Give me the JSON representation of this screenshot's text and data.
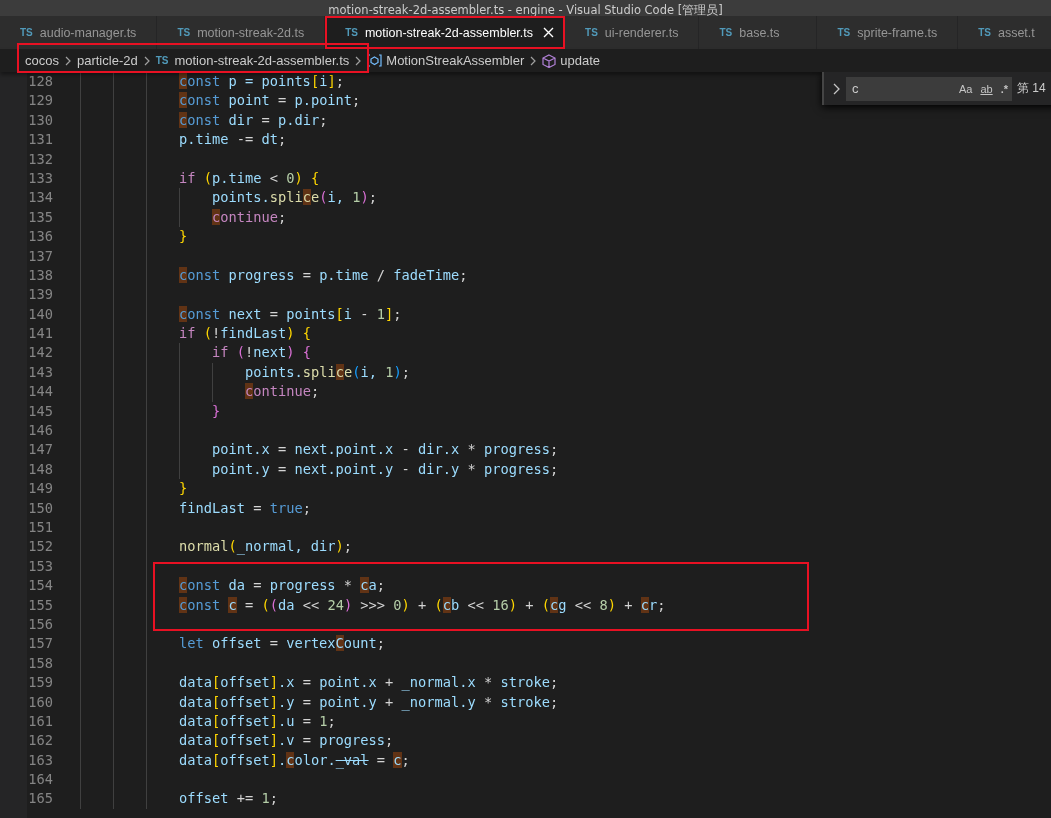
{
  "window": {
    "title": "motion-streak-2d-assembler.ts - engine - Visual Studio Code [管理员]"
  },
  "tabs": [
    {
      "badge": "TS",
      "label": "audio-manager.ts",
      "selected": false,
      "marked": false
    },
    {
      "badge": "TS",
      "label": "motion-streak-2d.ts",
      "selected": false,
      "marked": false
    },
    {
      "badge": "TS",
      "label": "motion-streak-2d-assembler.ts",
      "selected": true,
      "marked": true
    },
    {
      "badge": "TS",
      "label": "ui-renderer.ts",
      "selected": false,
      "marked": false
    },
    {
      "badge": "TS",
      "label": "base.ts",
      "selected": false,
      "marked": false
    },
    {
      "badge": "TS",
      "label": "sprite-frame.ts",
      "selected": false,
      "marked": false
    },
    {
      "badge": "TS",
      "label": "asset.t",
      "selected": false,
      "marked": false
    }
  ],
  "breadcrumb": [
    {
      "label": "cocos",
      "kind": "folder",
      "marked": true
    },
    {
      "label": "particle-2d",
      "kind": "folder",
      "marked": true
    },
    {
      "label": "motion-streak-2d-assembler.ts",
      "kind": "file",
      "badge": "TS",
      "marked": true
    },
    {
      "label": "MotionStreakAssembler",
      "kind": "class",
      "marked": false
    },
    {
      "label": "update",
      "kind": "method",
      "marked": false
    }
  ],
  "find": {
    "value": "c",
    "options": [
      {
        "label": "Aa",
        "kind": "case"
      },
      {
        "label": "ab",
        "kind": "word"
      },
      {
        "label": ".*",
        "kind": "regex"
      }
    ],
    "result": "第 14"
  },
  "lines": [
    {
      "number": "128",
      "marked": false,
      "tokens": [
        {
          "text": "c",
          "kind": "keyword",
          "found": true
        },
        {
          "text": "onst",
          "kind": "keyword",
          "found": false
        },
        {
          "text": " p = ",
          "kind": "variable",
          "found": false
        },
        {
          "text": "points",
          "kind": "variable",
          "found": false
        },
        {
          "text": "[",
          "kind": "bracket1",
          "found": false
        },
        {
          "text": "i",
          "kind": "variable",
          "found": false
        },
        {
          "text": "]",
          "kind": "bracket1",
          "found": false
        },
        {
          "text": ";",
          "kind": "operator",
          "found": false
        }
      ]
    },
    {
      "number": "129",
      "marked": false,
      "tokens": [
        {
          "text": "c",
          "kind": "keyword",
          "found": true
        },
        {
          "text": "onst",
          "kind": "keyword",
          "found": false
        },
        {
          "text": " point",
          "kind": "variable",
          "found": false
        },
        {
          "text": " = ",
          "kind": "operator",
          "found": false
        },
        {
          "text": "p.point",
          "kind": "variable",
          "found": false
        },
        {
          "text": ";",
          "kind": "operator",
          "found": false
        }
      ]
    },
    {
      "number": "130",
      "marked": false,
      "tokens": [
        {
          "text": "c",
          "kind": "keyword",
          "found": true
        },
        {
          "text": "onst",
          "kind": "keyword",
          "found": false
        },
        {
          "text": " dir",
          "kind": "variable",
          "found": false
        },
        {
          "text": " = ",
          "kind": "operator",
          "found": false
        },
        {
          "text": "p.dir",
          "kind": "variable",
          "found": false
        },
        {
          "text": ";",
          "kind": "operator",
          "found": false
        }
      ]
    },
    {
      "number": "131",
      "marked": false,
      "tokens": [
        {
          "text": "p.time",
          "kind": "variable",
          "found": false
        },
        {
          "text": " -= ",
          "kind": "operator",
          "found": false
        },
        {
          "text": "dt",
          "kind": "variable",
          "found": false
        },
        {
          "text": ";",
          "kind": "operator",
          "found": false
        }
      ]
    },
    {
      "number": "132",
      "marked": false
    },
    {
      "number": "133",
      "marked": false,
      "tokens": [
        {
          "text": "if",
          "kind": "control",
          "found": false
        },
        {
          "text": " (",
          "kind": "bracket1",
          "found": false
        },
        {
          "text": "p.time",
          "kind": "variable",
          "found": false
        },
        {
          "text": " < ",
          "kind": "operator",
          "found": false
        },
        {
          "text": "0",
          "kind": "number",
          "found": false
        },
        {
          "text": ") {",
          "kind": "bracket1",
          "found": false
        }
      ],
      "children": [
        {
          "number": "134",
          "marked": false,
          "tokens": [
            {
              "text": "points.",
              "kind": "variable",
              "found": false
            },
            {
              "text": "spli",
              "kind": "function",
              "found": false
            },
            {
              "text": "c",
              "kind": "function",
              "found": true
            },
            {
              "text": "e",
              "kind": "function",
              "found": false
            },
            {
              "text": "(",
              "kind": "bracket2",
              "found": false
            },
            {
              "text": "i,",
              "kind": "variable",
              "found": false
            },
            {
              "text": " 1",
              "kind": "number",
              "found": false
            },
            {
              "text": ")",
              "kind": "bracket2",
              "found": false
            },
            {
              "text": ";",
              "kind": "operator",
              "found": false
            }
          ]
        },
        {
          "number": "135",
          "marked": false,
          "tokens": [
            {
              "text": "c",
              "kind": "control",
              "found": true
            },
            {
              "text": "ontinue",
              "kind": "control",
              "found": false
            },
            {
              "text": ";",
              "kind": "operator",
              "found": false
            }
          ]
        }
      ]
    },
    {
      "number": "136",
      "marked": false,
      "tokens": [
        {
          "text": "}",
          "kind": "bracket1",
          "found": false
        }
      ]
    },
    {
      "number": "137",
      "marked": false
    },
    {
      "number": "138",
      "marked": false,
      "tokens": [
        {
          "text": "c",
          "kind": "keyword",
          "found": true
        },
        {
          "text": "onst",
          "kind": "keyword",
          "found": false
        },
        {
          "text": " progress",
          "kind": "variable",
          "found": false
        },
        {
          "text": " = ",
          "kind": "operator",
          "found": false
        },
        {
          "text": "p.time",
          "kind": "variable",
          "found": false
        },
        {
          "text": " / ",
          "kind": "operator",
          "found": false
        },
        {
          "text": "fadeTime",
          "kind": "variable",
          "found": false
        },
        {
          "text": ";",
          "kind": "operator",
          "found": false
        }
      ]
    },
    {
      "number": "139",
      "marked": false
    },
    {
      "number": "140",
      "marked": false,
      "tokens": [
        {
          "text": "c",
          "kind": "keyword",
          "found": true
        },
        {
          "text": "onst",
          "kind": "keyword",
          "found": false
        },
        {
          "text": " next",
          "kind": "variable",
          "found": false
        },
        {
          "text": " = ",
          "kind": "operator",
          "found": false
        },
        {
          "text": "points",
          "kind": "variable",
          "found": false
        },
        {
          "text": "[",
          "kind": "bracket1",
          "found": false
        },
        {
          "text": "i",
          "kind": "variable",
          "found": false
        },
        {
          "text": " - ",
          "kind": "operator",
          "found": false
        },
        {
          "text": "1",
          "kind": "number",
          "found": false
        },
        {
          "text": "]",
          "kind": "bracket1",
          "found": false
        },
        {
          "text": ";",
          "kind": "operator",
          "found": false
        }
      ]
    },
    {
      "number": "141",
      "marked": false,
      "tokens": [
        {
          "text": "if",
          "kind": "control",
          "found": false
        },
        {
          "text": " (",
          "kind": "bracket1",
          "found": false
        },
        {
          "text": "!",
          "kind": "operator",
          "found": false
        },
        {
          "text": "findLast",
          "kind": "variable",
          "found": false
        },
        {
          "text": ") {",
          "kind": "bracket1",
          "found": false
        }
      ],
      "children": [
        {
          "number": "142",
          "marked": false,
          "tokens": [
            {
              "text": "if",
              "kind": "control",
              "found": false
            },
            {
              "text": " (",
              "kind": "bracket2",
              "found": false
            },
            {
              "text": "!",
              "kind": "operator",
              "found": false
            },
            {
              "text": "next",
              "kind": "variable",
              "found": false
            },
            {
              "text": ") {",
              "kind": "bracket2",
              "found": false
            }
          ],
          "children": [
            {
              "number": "143",
              "marked": false,
              "tokens": [
                {
                  "text": "points.",
                  "kind": "variable",
                  "found": false
                },
                {
                  "text": "spli",
                  "kind": "function",
                  "found": false
                },
                {
                  "text": "c",
                  "kind": "function",
                  "found": true
                },
                {
                  "text": "e",
                  "kind": "function",
                  "found": false
                },
                {
                  "text": "(",
                  "kind": "bracket3",
                  "found": false
                },
                {
                  "text": "i,",
                  "kind": "variable",
                  "found": false
                },
                {
                  "text": " 1",
                  "kind": "number",
                  "found": false
                },
                {
                  "text": ")",
                  "kind": "bracket3",
                  "found": false
                },
                {
                  "text": ";",
                  "kind": "operator",
                  "found": false
                }
              ]
            },
            {
              "number": "144",
              "marked": false,
              "tokens": [
                {
                  "text": "c",
                  "kind": "control",
                  "found": true
                },
                {
                  "text": "ontinue",
                  "kind": "control",
                  "found": false
                },
                {
                  "text": ";",
                  "kind": "operator",
                  "found": false
                }
              ]
            }
          ]
        },
        {
          "number": "145",
          "marked": false,
          "tokens": [
            {
              "text": "}",
              "kind": "bracket2",
              "found": false
            }
          ]
        },
        {
          "number": "146",
          "marked": false
        },
        {
          "number": "147",
          "marked": false,
          "tokens": [
            {
              "text": "point.x",
              "kind": "variable",
              "found": false
            },
            {
              "text": " = ",
              "kind": "operator",
              "found": false
            },
            {
              "text": "next.point.x",
              "kind": "variable",
              "found": false
            },
            {
              "text": " - ",
              "kind": "operator",
              "found": false
            },
            {
              "text": "dir.x",
              "kind": "variable",
              "found": false
            },
            {
              "text": " * ",
              "kind": "operator",
              "found": false
            },
            {
              "text": "progress",
              "kind": "variable",
              "found": false
            },
            {
              "text": ";",
              "kind": "operator",
              "found": false
            }
          ]
        },
        {
          "number": "148",
          "marked": false,
          "tokens": [
            {
              "text": "point.y",
              "kind": "variable",
              "found": false
            },
            {
              "text": " = ",
              "kind": "operator",
              "found": false
            },
            {
              "text": "next.point.y",
              "kind": "variable",
              "found": false
            },
            {
              "text": " - ",
              "kind": "operator",
              "found": false
            },
            {
              "text": "dir.y",
              "kind": "variable",
              "found": false
            },
            {
              "text": " * ",
              "kind": "operator",
              "found": false
            },
            {
              "text": "progress",
              "kind": "variable",
              "found": false
            },
            {
              "text": ";",
              "kind": "operator",
              "found": false
            }
          ]
        }
      ]
    },
    {
      "number": "149",
      "marked": false,
      "tokens": [
        {
          "text": "}",
          "kind": "bracket1",
          "found": false
        }
      ]
    },
    {
      "number": "150",
      "marked": false,
      "tokens": [
        {
          "text": "findLast",
          "kind": "variable",
          "found": false
        },
        {
          "text": " = ",
          "kind": "operator",
          "found": false
        },
        {
          "text": "true",
          "kind": "keyword",
          "found": false
        },
        {
          "text": ";",
          "kind": "operator",
          "found": false
        }
      ]
    },
    {
      "number": "151",
      "marked": false
    },
    {
      "number": "152",
      "marked": false,
      "tokens": [
        {
          "text": "normal",
          "kind": "function",
          "found": false
        },
        {
          "text": "(",
          "kind": "bracket1",
          "found": false
        },
        {
          "text": "_normal, dir",
          "kind": "variable",
          "found": false
        },
        {
          "text": ")",
          "kind": "bracket1",
          "found": false
        },
        {
          "text": ";",
          "kind": "operator",
          "found": false
        }
      ]
    },
    {
      "number": "153",
      "marked": true
    },
    {
      "number": "154",
      "marked": true,
      "tokens": [
        {
          "text": "c",
          "kind": "keyword",
          "found": true
        },
        {
          "text": "onst",
          "kind": "keyword",
          "found": false
        },
        {
          "text": " da",
          "kind": "variable",
          "found": false
        },
        {
          "text": " = ",
          "kind": "operator",
          "found": false
        },
        {
          "text": "progress",
          "kind": "variable",
          "found": false
        },
        {
          "text": " * ",
          "kind": "operator",
          "found": false
        },
        {
          "text": "c",
          "kind": "variable",
          "found": true
        },
        {
          "text": "a",
          "kind": "variable",
          "found": false
        },
        {
          "text": ";",
          "kind": "operator",
          "found": false
        }
      ]
    },
    {
      "number": "155",
      "marked": true,
      "tokens": [
        {
          "text": "c",
          "kind": "keyword",
          "found": true
        },
        {
          "text": "onst ",
          "kind": "keyword",
          "found": false
        },
        {
          "text": "c",
          "kind": "variable",
          "found": true
        },
        {
          "text": " = ",
          "kind": "operator",
          "found": false
        },
        {
          "text": "(",
          "kind": "bracket1",
          "found": false
        },
        {
          "text": "(",
          "kind": "bracket2",
          "found": false
        },
        {
          "text": "da",
          "kind": "variable",
          "found": false
        },
        {
          "text": " << ",
          "kind": "operator",
          "found": false
        },
        {
          "text": "24",
          "kind": "number",
          "found": false
        },
        {
          "text": ")",
          "kind": "bracket2",
          "found": false
        },
        {
          "text": " >>> ",
          "kind": "operator",
          "found": false
        },
        {
          "text": "0",
          "kind": "number",
          "found": false
        },
        {
          "text": ")",
          "kind": "bracket1",
          "found": false
        },
        {
          "text": " + ",
          "kind": "operator",
          "found": false
        },
        {
          "text": "(",
          "kind": "bracket1",
          "found": false
        },
        {
          "text": "c",
          "kind": "variable",
          "found": true
        },
        {
          "text": "b",
          "kind": "variable",
          "found": false
        },
        {
          "text": " << ",
          "kind": "operator",
          "found": false
        },
        {
          "text": "16",
          "kind": "number",
          "found": false
        },
        {
          "text": ")",
          "kind": "bracket1",
          "found": false
        },
        {
          "text": " + ",
          "kind": "operator",
          "found": false
        },
        {
          "text": "(",
          "kind": "bracket1",
          "found": false
        },
        {
          "text": "c",
          "kind": "variable",
          "found": true
        },
        {
          "text": "g",
          "kind": "variable",
          "found": false
        },
        {
          "text": " << ",
          "kind": "operator",
          "found": false
        },
        {
          "text": "8",
          "kind": "number",
          "found": false
        },
        {
          "text": ")",
          "kind": "bracket1",
          "found": false
        },
        {
          "text": " + ",
          "kind": "operator",
          "found": false
        },
        {
          "text": "c",
          "kind": "variable",
          "found": true
        },
        {
          "text": "r",
          "kind": "variable",
          "found": false
        },
        {
          "text": ";",
          "kind": "operator",
          "found": false
        }
      ]
    },
    {
      "number": "156",
      "marked": true
    },
    {
      "number": "157",
      "marked": false,
      "tokens": [
        {
          "text": "let",
          "kind": "keyword",
          "found": false
        },
        {
          "text": " offset",
          "kind": "variable",
          "found": false
        },
        {
          "text": " = ",
          "kind": "operator",
          "found": false
        },
        {
          "text": "vertex",
          "kind": "variable",
          "found": false
        },
        {
          "text": "C",
          "kind": "variable",
          "found": true
        },
        {
          "text": "ount",
          "kind": "variable",
          "found": false
        },
        {
          "text": ";",
          "kind": "operator",
          "found": false
        }
      ]
    },
    {
      "number": "158",
      "marked": false
    },
    {
      "number": "159",
      "marked": false,
      "tokens": [
        {
          "text": "data",
          "kind": "variable",
          "found": false
        },
        {
          "text": "[",
          "kind": "bracket1",
          "found": false
        },
        {
          "text": "offset",
          "kind": "variable",
          "found": false
        },
        {
          "text": "]",
          "kind": "bracket1",
          "found": false
        },
        {
          "text": ".x",
          "kind": "variable",
          "found": false
        },
        {
          "text": " = ",
          "kind": "operator",
          "found": false
        },
        {
          "text": "point.x",
          "kind": "variable",
          "found": false
        },
        {
          "text": " + ",
          "kind": "operator",
          "found": false
        },
        {
          "text": "_normal.x",
          "kind": "variable",
          "found": false
        },
        {
          "text": " * ",
          "kind": "operator",
          "found": false
        },
        {
          "text": "stroke",
          "kind": "variable",
          "found": false
        },
        {
          "text": ";",
          "kind": "operator",
          "found": false
        }
      ]
    },
    {
      "number": "160",
      "marked": false,
      "tokens": [
        {
          "text": "data",
          "kind": "variable",
          "found": false
        },
        {
          "text": "[",
          "kind": "bracket1",
          "found": false
        },
        {
          "text": "offset",
          "kind": "variable",
          "found": false
        },
        {
          "text": "]",
          "kind": "bracket1",
          "found": false
        },
        {
          "text": ".y",
          "kind": "variable",
          "found": false
        },
        {
          "text": " = ",
          "kind": "operator",
          "found": false
        },
        {
          "text": "point.y",
          "kind": "variable",
          "found": false
        },
        {
          "text": " + ",
          "kind": "operator",
          "found": false
        },
        {
          "text": "_normal.y",
          "kind": "variable",
          "found": false
        },
        {
          "text": " * ",
          "kind": "operator",
          "found": false
        },
        {
          "text": "stroke",
          "kind": "variable",
          "found": false
        },
        {
          "text": ";",
          "kind": "operator",
          "found": false
        }
      ]
    },
    {
      "number": "161",
      "marked": false,
      "tokens": [
        {
          "text": "data",
          "kind": "variable",
          "found": false
        },
        {
          "text": "[",
          "kind": "bracket1",
          "found": false
        },
        {
          "text": "offset",
          "kind": "variable",
          "found": false
        },
        {
          "text": "]",
          "kind": "bracket1",
          "found": false
        },
        {
          "text": ".u",
          "kind": "variable",
          "found": false
        },
        {
          "text": " = ",
          "kind": "operator",
          "found": false
        },
        {
          "text": "1",
          "kind": "number",
          "found": false
        },
        {
          "text": ";",
          "kind": "operator",
          "found": false
        }
      ]
    },
    {
      "number": "162",
      "marked": false,
      "tokens": [
        {
          "text": "data",
          "kind": "variable",
          "found": false
        },
        {
          "text": "[",
          "kind": "bracket1",
          "found": false
        },
        {
          "text": "offset",
          "kind": "variable",
          "found": false
        },
        {
          "text": "]",
          "kind": "bracket1",
          "found": false
        },
        {
          "text": ".v",
          "kind": "variable",
          "found": false
        },
        {
          "text": " = ",
          "kind": "operator",
          "found": false
        },
        {
          "text": "progress",
          "kind": "variable",
          "found": false
        },
        {
          "text": ";",
          "kind": "operator",
          "found": false
        }
      ]
    },
    {
      "number": "163",
      "marked": false,
      "tokens": [
        {
          "text": "data",
          "kind": "variable",
          "found": false
        },
        {
          "text": "[",
          "kind": "bracket1",
          "found": false
        },
        {
          "text": "offset",
          "kind": "variable",
          "found": false
        },
        {
          "text": "]",
          "kind": "bracket1",
          "found": false
        },
        {
          "text": ".",
          "kind": "variable",
          "found": false
        },
        {
          "text": "c",
          "kind": "variable",
          "found": true
        },
        {
          "text": "olor.",
          "kind": "variable",
          "found": false
        },
        {
          "text": "_val",
          "kind": "deprecated",
          "found": false
        },
        {
          "text": " = ",
          "kind": "operator",
          "found": false
        },
        {
          "text": "c",
          "kind": "variable",
          "found": true
        },
        {
          "text": ";",
          "kind": "operator",
          "found": false
        }
      ]
    },
    {
      "number": "164",
      "marked": false
    },
    {
      "number": "165",
      "marked": false,
      "tokens": [
        {
          "text": "offset",
          "kind": "variable",
          "found": false
        },
        {
          "text": " += ",
          "kind": "operator",
          "found": false
        },
        {
          "text": "1",
          "kind": "number",
          "found": false
        },
        {
          "text": ";",
          "kind": "operator",
          "found": false
        }
      ]
    }
  ]
}
